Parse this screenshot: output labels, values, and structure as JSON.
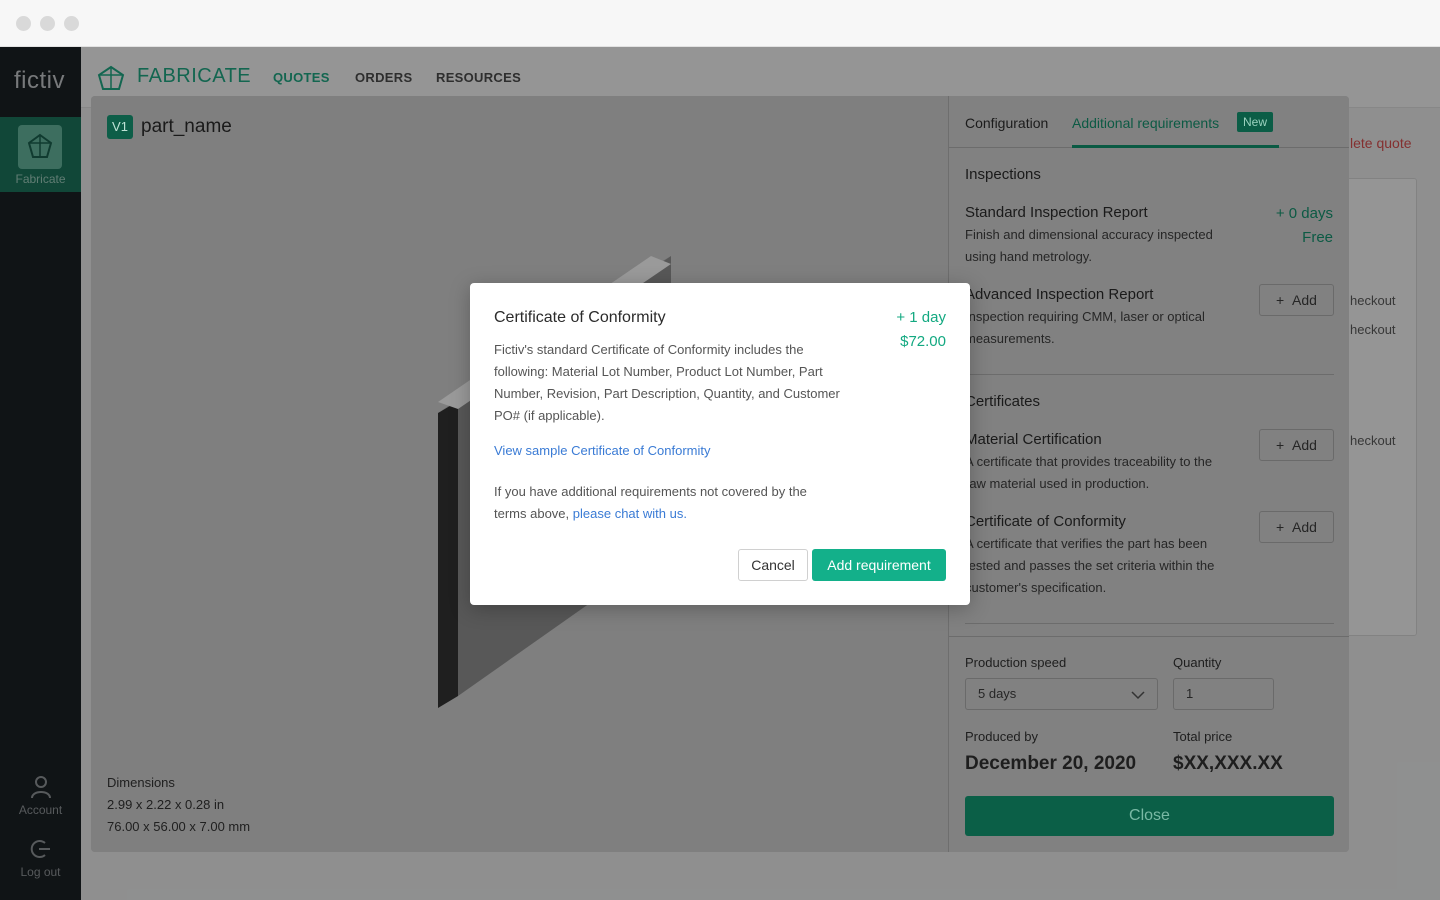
{
  "app": {
    "logo": "fictiv",
    "brand": "FABRICATE"
  },
  "nav": {
    "items": [
      "QUOTES",
      "ORDERS",
      "RESOURCES"
    ]
  },
  "sidebar": {
    "fabricate_label": "Fabricate",
    "account_label": "Account",
    "logout_label": "Log out"
  },
  "background": {
    "delete_quote": "lete quote",
    "checkout_1": "heckout",
    "checkout_2": "heckout",
    "checkout_3": "heckout"
  },
  "part": {
    "version": "V1",
    "name": "part_name",
    "dimensions_label": "Dimensions",
    "dimensions_in": "2.99 x 2.22 x 0.28 in",
    "dimensions_mm": "76.00 x 56.00 x 7.00 mm"
  },
  "tabs": {
    "configuration": "Configuration",
    "additional": "Additional requirements",
    "new_badge": "New"
  },
  "inspections": {
    "title": "Inspections",
    "standard": {
      "title": "Standard Inspection Report",
      "desc": "Finish and dimensional accuracy inspected using hand metrology.",
      "days": "+ 0 days",
      "price": "Free"
    },
    "advanced": {
      "title": "Advanced Inspection Report",
      "desc": "Inspection requiring CMM, laser or optical measurements.",
      "add": "Add"
    }
  },
  "certificates": {
    "title": "Certificates",
    "material": {
      "title": "Material Certification",
      "desc": "A certificate that provides traceability to the raw material used in production.",
      "add": "Add"
    },
    "conformity": {
      "title": "Certificate of Conformity",
      "desc": "A certificate that verifies the part has been tested and passes the set criteria within the customer's specification.",
      "add": "Add"
    }
  },
  "footer": {
    "speed_label": "Production speed",
    "speed_value": "5 days",
    "quantity_label": "Quantity",
    "quantity_value": "1",
    "produced_label": "Produced by",
    "produced_value": "December 20, 2020",
    "total_label": "Total price",
    "total_value": "$XX,XXX.XX",
    "close": "Close"
  },
  "dialog": {
    "title": "Certificate of Conformity",
    "days": "+ 1 day",
    "price": "$72.00",
    "body": "Fictiv's standard Certificate of Conformity includes the following: Material Lot Number, Product Lot Number, Part Number, Revision, Part Description, Quantity, and Customer PO# (if applicable).",
    "sample_link": "View sample Certificate of Conformity",
    "more_text": "If you have additional requirements not covered by the terms above,",
    "chat_link": "please chat with us.",
    "cancel": "Cancel",
    "add": "Add requirement"
  },
  "colors": {
    "brand_green": "#13a981",
    "link_blue": "#3a7bd5",
    "sidebar": "#0e1418"
  }
}
